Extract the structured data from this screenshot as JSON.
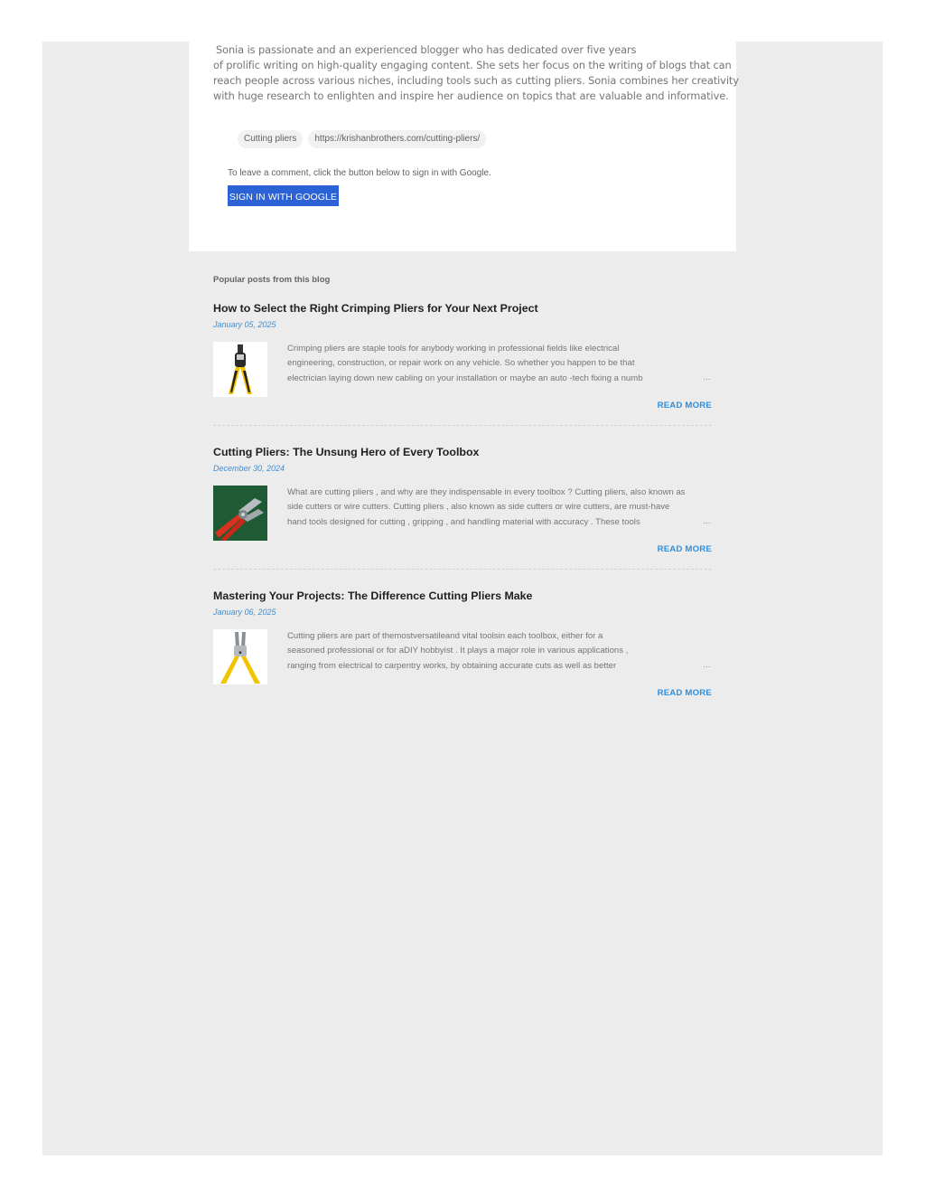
{
  "post": {
    "bio_lines": [
      "Sonia is passionate and an experienced blogger who has dedicated over five years",
      "of prolific writing on high-quality engaging content. She sets her focus on the writing of blogs that can",
      "reach people across various niches, including tools such as cutting pliers. Sonia combines her creativity",
      "with huge research to enlighten and inspire her audience on topics that are valuable and informative."
    ],
    "labels": [
      "Cutting pliers",
      "https://krishanbrothers.com/cutting-pliers/"
    ],
    "comment_note": "To leave a comment, click the button below to sign in with Google.",
    "signin_label": "SIGN IN WITH GOOGLE"
  },
  "popular": {
    "heading": "Popular posts from this blog",
    "read_more_label": "READ MORE",
    "ellipsis": "…",
    "posts": [
      {
        "title": "How to Select the Right Crimping Pliers for Your Next Project",
        "date": "January 05, 2025",
        "thumb_icon": "crimping-pliers-image",
        "snippet_lines": [
          "Crimping pliers are  staple  tools for  anybody   working  in  professional  fields like electrical",
          "engineering, construction,  or   repair   work on any vehicle.   So  whether you   happen   to be that",
          "electrician  laying   down   new  cabling on your  installation or  maybe  an auto -tech   fixing   a   numb"
        ]
      },
      {
        "title": "Cutting Pliers: The Unsung Hero of Every Toolbox",
        "date": "December 30, 2024",
        "thumb_icon": "cutting-pliers-green-image",
        "snippet_lines": [
          "What are cutting pliers ,  and why are they  indispensable in every toolbox ? Cutting pliers, also known as",
          "side cutters or wire cutters. Cutting pliers , also known as side cutters or wire cutters, are  must-have",
          " hand tools designed  for   cutting ,  gripping , and  handling   material  with  accuracy .  These   tools"
        ]
      },
      {
        "title": "Mastering Your Projects: The Difference Cutting Pliers Make",
        "date": "January 06, 2025",
        "thumb_icon": "yellow-cutting-pliers-image",
        "snippet_lines": [
          "Cutting pliers   are  part   of  themostversatileand  vital  toolsin  each   toolbox,   either    for   a",
          "seasoned  professional or  for  aDIY  hobbyist .  It   plays   a   major   role in various applications ,",
          "ranging   from   electrical   to   carpentry   works,   by   obtaining   accurate  cuts  as   well   as better"
        ]
      }
    ]
  }
}
